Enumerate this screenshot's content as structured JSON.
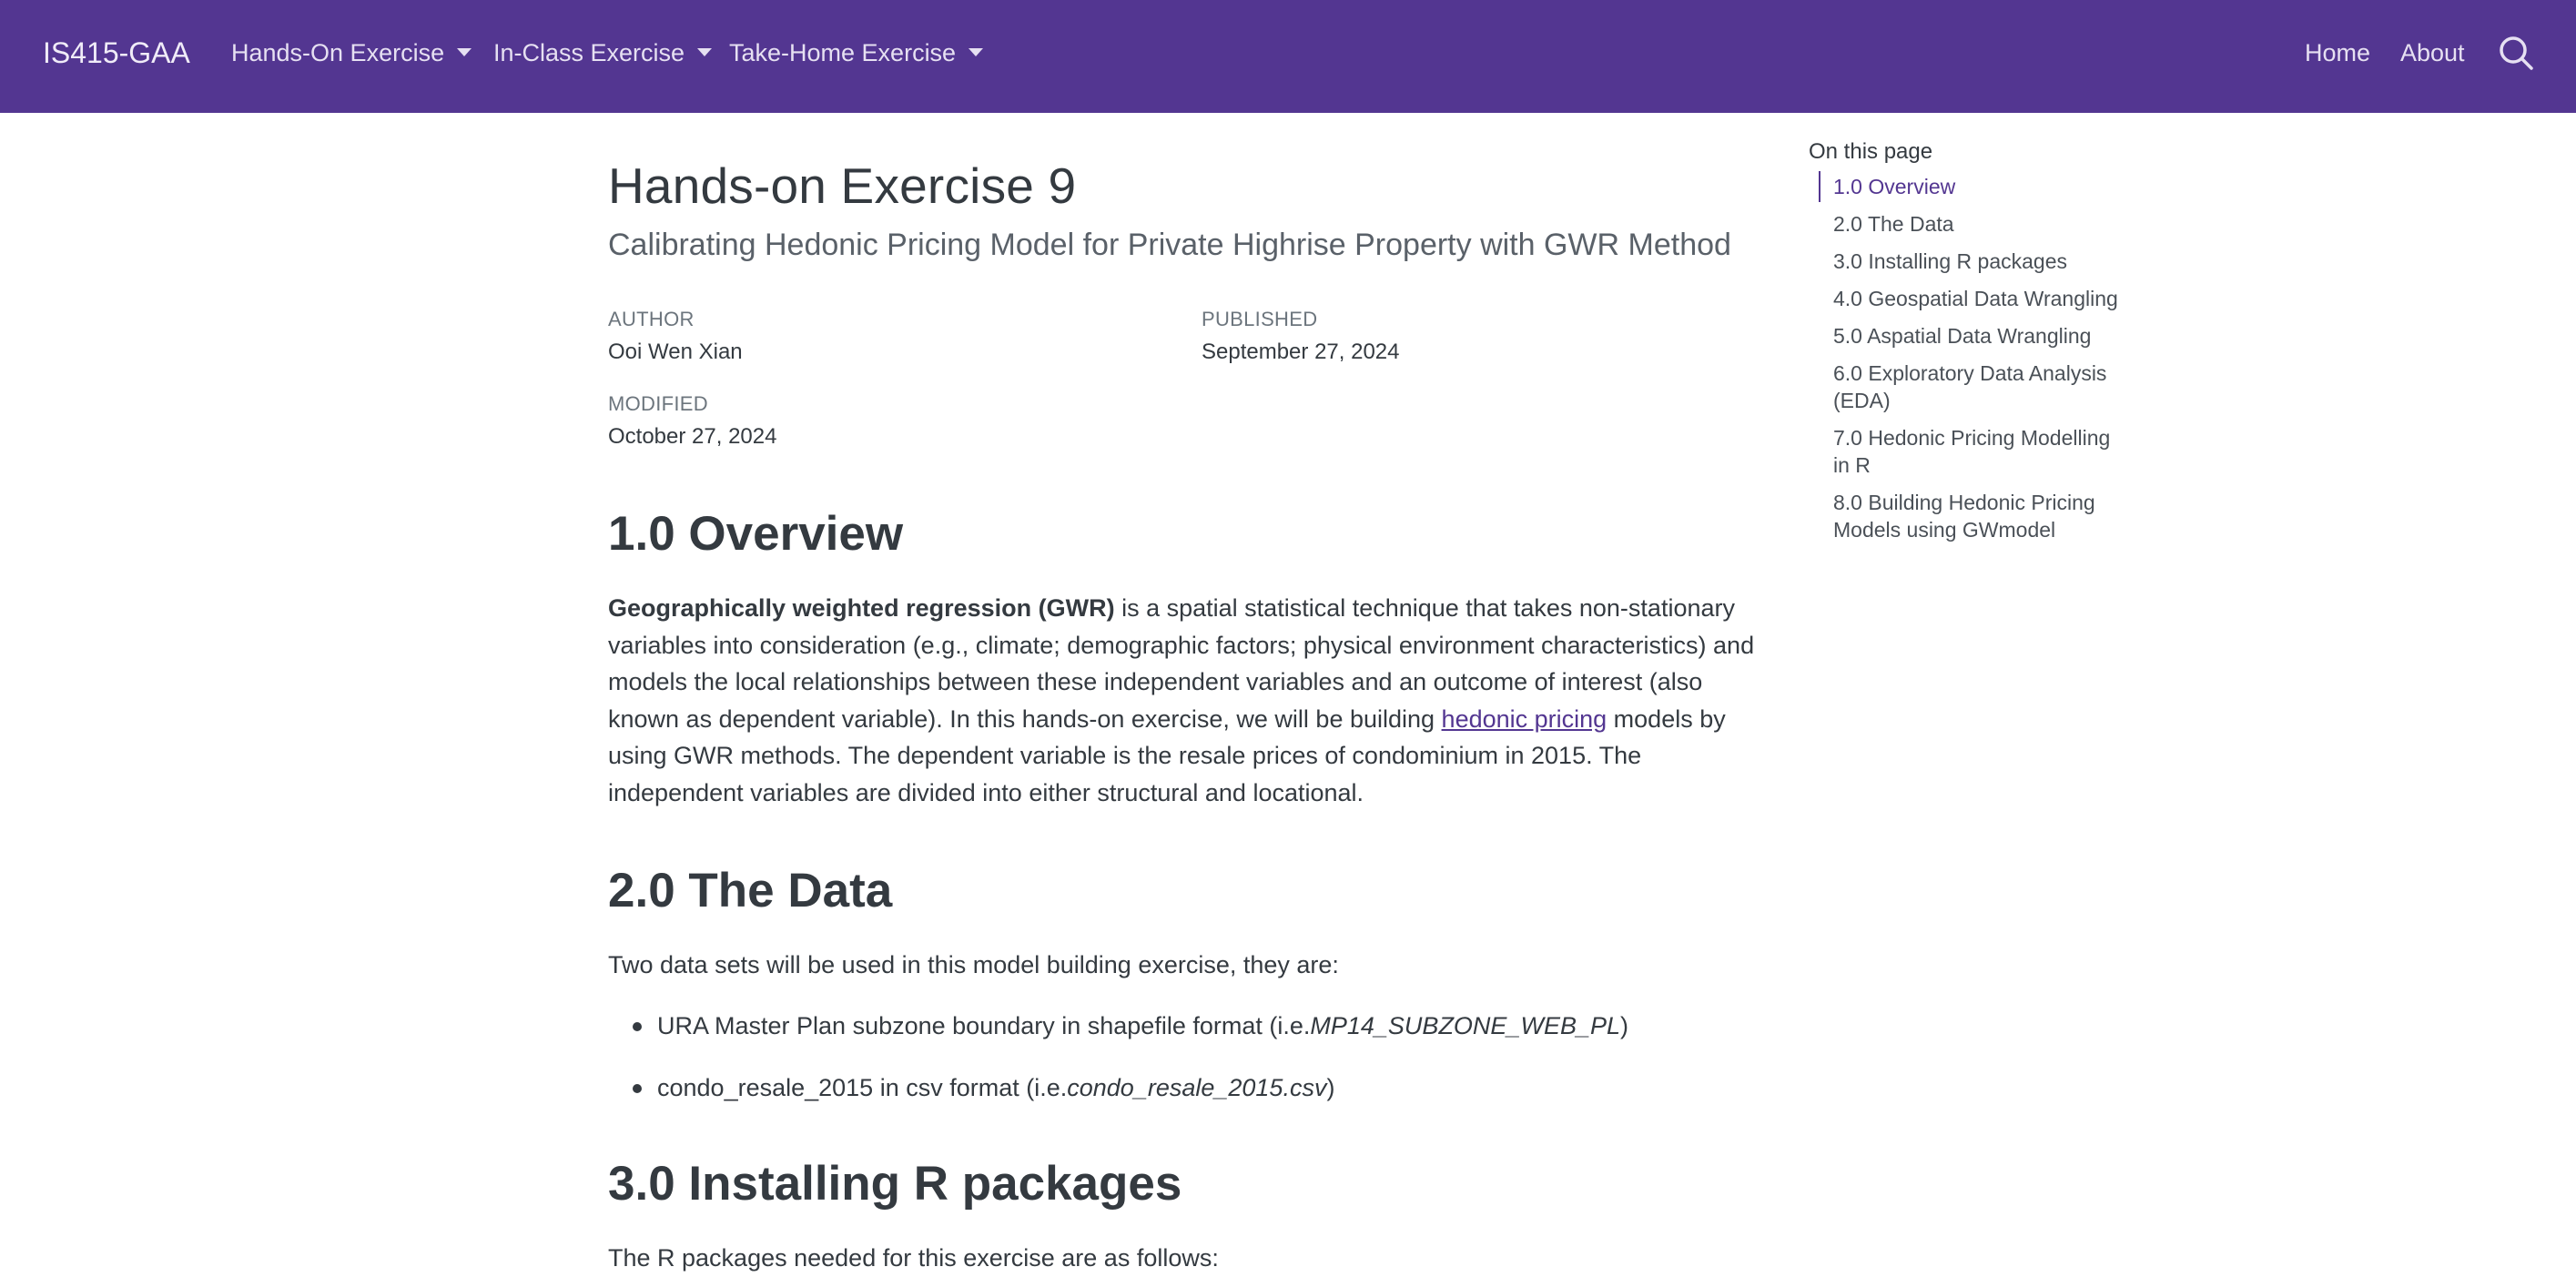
{
  "navbar": {
    "brand": "IS415-GAA",
    "menus": [
      {
        "label": "Hands-On Exercise"
      },
      {
        "label": "In-Class Exercise"
      },
      {
        "label": "Take-Home Exercise"
      }
    ],
    "right_links": [
      {
        "label": "Home"
      },
      {
        "label": "About"
      }
    ],
    "search_icon": "search-icon"
  },
  "header": {
    "title": "Hands-on Exercise 9",
    "subtitle": "Calibrating Hedonic Pricing Model for Private Highrise Property with GWR Method",
    "author_label": "AUTHOR",
    "author": "Ooi Wen Xian",
    "published_label": "PUBLISHED",
    "published": "September 27, 2024",
    "modified_label": "MODIFIED",
    "modified": "October 27, 2024"
  },
  "sections": {
    "overview": {
      "heading": "1.0 Overview",
      "bold_term": "Geographically weighted regression (GWR)",
      "text_1": " is a spatial statistical technique that takes non-stationary variables into consideration (e.g., climate; demographic factors; physical environment characteristics) and models the local relationships between these independent variables and an outcome of interest (also known as dependent variable). In this hands-on exercise, we will be building ",
      "link": "hedonic pricing",
      "text_2": " models by using GWR methods. The dependent variable is the resale prices of condominium in 2015. The independent variables are divided into either structural and locational."
    },
    "data": {
      "heading": "2.0 The Data",
      "intro": "Two data sets will be used in this model building exercise, they are:",
      "items": [
        {
          "text": "URA Master Plan subzone boundary in shapefile format (i.e.",
          "italic": "MP14_SUBZONE_WEB_PL",
          "end": ")"
        },
        {
          "text": "condo_resale_2015 in csv format (i.e.",
          "italic": "condo_resale_2015.csv",
          "end": ")"
        }
      ]
    },
    "packages": {
      "heading": "3.0 Installing R packages",
      "intro": "The R packages needed for this exercise are as follows:"
    }
  },
  "toc": {
    "title": "On this page",
    "items": [
      {
        "label": "1.0 Overview"
      },
      {
        "label": "2.0 The Data"
      },
      {
        "label": "3.0 Installing R packages"
      },
      {
        "label": "4.0 Geospatial Data Wrangling"
      },
      {
        "label": "5.0 Aspatial Data Wrangling"
      },
      {
        "label": "6.0 Exploratory Data Analysis (EDA)"
      },
      {
        "label": "7.0 Hedonic Pricing Modelling in R"
      },
      {
        "label": "8.0 Building Hedonic Pricing Models using GWmodel"
      }
    ]
  },
  "colors": {
    "navbar": "#533691",
    "accent": "#533691",
    "text": "#343a40"
  }
}
